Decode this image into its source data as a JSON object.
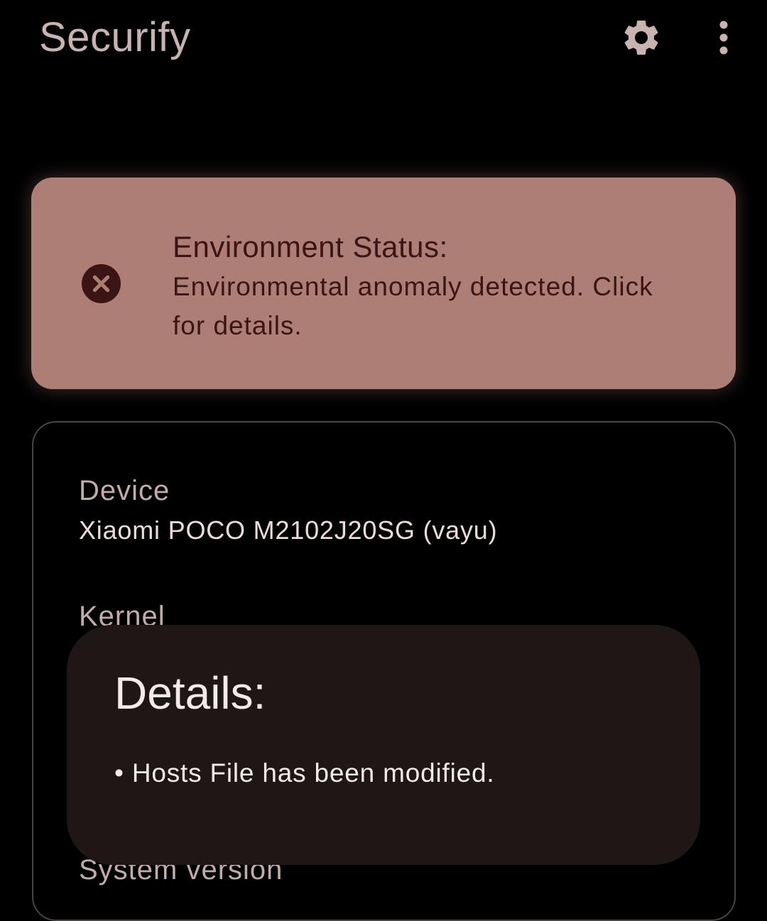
{
  "app": {
    "title": "Securify"
  },
  "toolbar": {
    "settings_icon": "gear-icon",
    "more_icon": "more-vertical-icon"
  },
  "status_card": {
    "icon": "error-x-icon",
    "title": "Environment Status:",
    "description": "Environmental anomaly detected. Click for details."
  },
  "device_info": {
    "device_label": "Device",
    "device_value": "Xiaomi POCO M2102J20SG  (vayu)",
    "kernel_label": "Kernel",
    "system_version_label": "System version"
  },
  "details_dialog": {
    "title": "Details:",
    "items": [
      "• Hosts File has been modified."
    ]
  },
  "colors": {
    "background": "#000000",
    "status_card": "#ad7e76",
    "status_text": "#3a1513",
    "dialog_background": "#1e1716"
  }
}
